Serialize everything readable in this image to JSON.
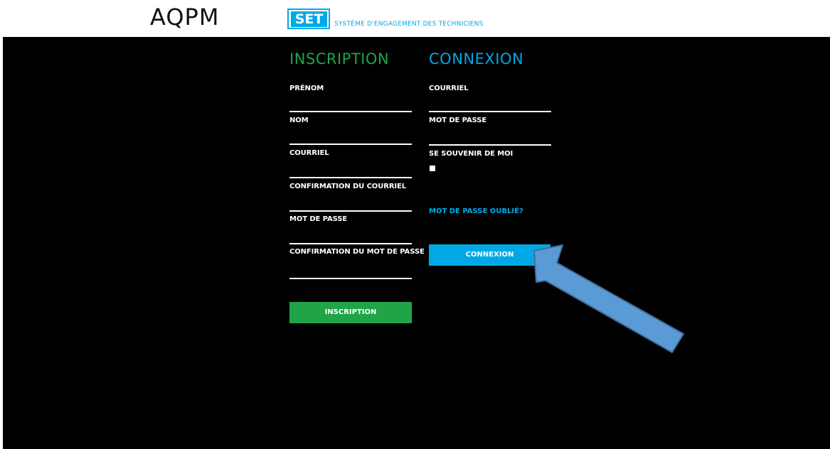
{
  "header": {
    "logo_text": "AQPM",
    "set_label": "SET",
    "set_subtitle": "SYSTÈME D'ENGAGEMENT DES TECHNICIENS"
  },
  "inscription": {
    "title": "INSCRIPTION",
    "fields": [
      {
        "label": "PRÉNOM",
        "value": ""
      },
      {
        "label": "NOM",
        "value": ""
      },
      {
        "label": "COURRIEL",
        "value": ""
      },
      {
        "label": "CONFIRMATION DU COURRIEL",
        "value": ""
      },
      {
        "label": "MOT DE PASSE",
        "value": ""
      },
      {
        "label": "CONFIRMATION DU MOT DE PASSE",
        "value": ""
      }
    ],
    "button_label": "INSCRIPTION"
  },
  "connexion": {
    "title": "CONNEXION",
    "fields": [
      {
        "label": "COURRIEL",
        "value": ""
      },
      {
        "label": "MOT DE PASSE",
        "value": ""
      }
    ],
    "remember_label": "SE SOUVENIR DE MOI",
    "forgot_link": "MOT DE PASSE OUBLIÉ?",
    "button_label": "CONNEXION"
  },
  "colors": {
    "green": "#1fa548",
    "blue": "#00a9e6",
    "arrow": "#5b9bd5"
  }
}
